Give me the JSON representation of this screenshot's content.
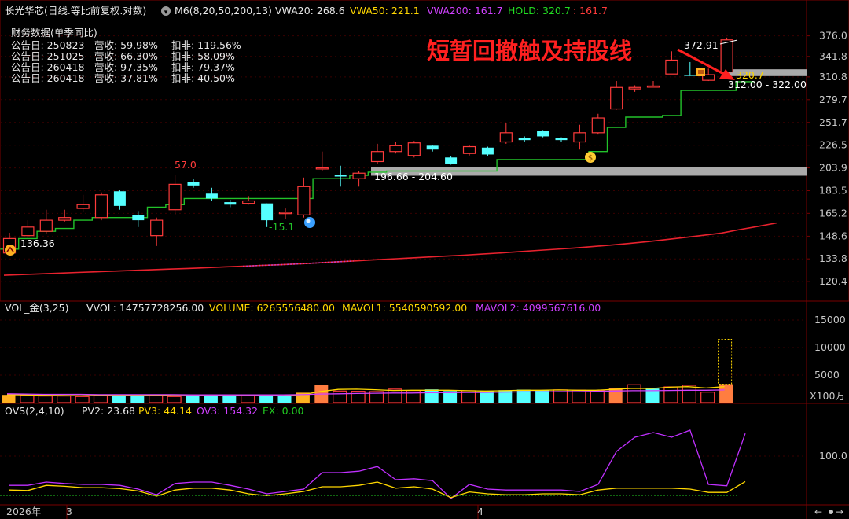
{
  "colors": {
    "background": "#000000",
    "grid": "#3a0000",
    "axis_text": "#c8c8c8",
    "up": "#ff3b3b",
    "down": "#55ffff",
    "hold_line": "#22c22a",
    "ma_red": "#e8222e",
    "ma_magenta": "#c040c0",
    "yellow": "#ffd700",
    "white": "#ffffff",
    "annotation_red": "#ff2020",
    "band": "#aaaaaa",
    "gold_bar": "#ffb020",
    "orange_bar": "#ff7d40",
    "vol_avg_yellow": "#ffd700",
    "vol_avg_magenta": "#d040ff",
    "ovs_purple": "#c030ff",
    "ovs_yellow": "#ffd700",
    "ovs_green": "#22cc22"
  },
  "header": {
    "ticker": "长光华芯(日线.等比前复权.对数)",
    "ma": "M6(8,20,50,200,13)",
    "vwa20": "VWA20: 268.6",
    "vwa50": "VWA50: 221.1",
    "vwa200": "VWA200: 161.7",
    "hold": "HOLD: 320.7",
    "hold2": ": 161.7"
  },
  "finance": {
    "title": "财务数据(单季同比)",
    "rows": [
      {
        "date": "公告日: 250823",
        "rev": "营收:  59.98%",
        "np": "扣非:  119.56%"
      },
      {
        "date": "公告日: 251025",
        "rev": "营收:  66.30%",
        "np": "扣非:  58.09%"
      },
      {
        "date": "公告日: 260418",
        "rev": "营收:  97.35%",
        "np": "扣非:  79.37%"
      },
      {
        "date": "公告日: 260418",
        "rev": "营收:  37.81%",
        "np": "扣非:  40.50%"
      }
    ]
  },
  "annotation": "短暂回撤触及持股线",
  "price_labels": {
    "high": "372.91",
    "hold_value": "320.7",
    "zone_top": "312.00 - 322.00",
    "zone_mid": "196.66 - 204.60",
    "peak_57": "57.0",
    "dip": "-15.1",
    "low": "136.36"
  },
  "volume": {
    "title": "VOL_金(3,25)",
    "vvol": "VVOL: 14757728256.00",
    "volume": "VOLUME: 6265556480.00",
    "mavol1": "MAVOL1: 5540590592.00",
    "mavol2": "MAVOL2: 4099567616.00",
    "unit": "X100万"
  },
  "ovs": {
    "title": "OVS(2,4,10)",
    "pv2": "PV2: 23.68",
    "pv3": "PV3: 44.14",
    "ov3": "OV3: 154.32",
    "ex": "EX: 0.00"
  },
  "xaxis": {
    "year": "2026年",
    "m3": "3",
    "m4": "4"
  },
  "chart_data": [
    {
      "type": "candlestick",
      "scale": "log",
      "y_ticks": [
        120.4,
        133.8,
        148.6,
        165.2,
        183.5,
        203.9,
        226.5,
        251.7,
        279.7,
        310.8,
        341.8,
        376.0
      ],
      "ylim": [
        112.0,
        398.0
      ],
      "candles": [
        {
          "o": 137.5,
          "c": 147.0,
          "h": 151.0,
          "l": 136.4
        },
        {
          "o": 149.0,
          "c": 155.0,
          "h": 160.0,
          "l": 147.5
        },
        {
          "o": 152.0,
          "c": 160.0,
          "h": 168.0,
          "l": 150.5
        },
        {
          "o": 160.0,
          "c": 162.0,
          "h": 168.0,
          "l": 159.0
        },
        {
          "o": 169.0,
          "c": 172.0,
          "h": 180.0,
          "l": 166.0
        },
        {
          "o": 162.0,
          "c": 180.0,
          "h": 182.0,
          "l": 160.0
        },
        {
          "o": 183.0,
          "c": 171.0,
          "h": 184.0,
          "l": 168.0
        },
        {
          "o": 164.0,
          "c": 160.0,
          "h": 167.0,
          "l": 155.0
        },
        {
          "o": 149.0,
          "c": 160.0,
          "h": 162.0,
          "l": 142.0
        },
        {
          "o": 168.0,
          "c": 189.0,
          "h": 197.0,
          "l": 164.0
        },
        {
          "o": 191.0,
          "c": 188.0,
          "h": 194.0,
          "l": 186.0
        },
        {
          "o": 181.0,
          "c": 177.0,
          "h": 186.0,
          "l": 175.0
        },
        {
          "o": 174.0,
          "c": 172.0,
          "h": 176.0,
          "l": 170.0
        },
        {
          "o": 173.0,
          "c": 175.0,
          "h": 179.0,
          "l": 172.0
        },
        {
          "o": 173.0,
          "c": 160.0,
          "h": 173.0,
          "l": 155.0
        },
        {
          "o": 165.0,
          "c": 166.0,
          "h": 169.0,
          "l": 161.0
        },
        {
          "o": 164.0,
          "c": 187.0,
          "h": 195.0,
          "l": 162.0
        },
        {
          "o": 203.0,
          "c": 204.0,
          "h": 220.0,
          "l": 201.0
        },
        {
          "o": 197.0,
          "c": 196.5,
          "h": 206.0,
          "l": 187.0
        },
        {
          "o": 194.0,
          "c": 199.0,
          "h": 201.0,
          "l": 187.0
        },
        {
          "o": 210.0,
          "c": 220.0,
          "h": 228.0,
          "l": 208.0
        },
        {
          "o": 220.0,
          "c": 226.0,
          "h": 230.0,
          "l": 218.0
        },
        {
          "o": 216.0,
          "c": 229.0,
          "h": 231.0,
          "l": 214.0
        },
        {
          "o": 226.0,
          "c": 222.0,
          "h": 227.0,
          "l": 220.0
        },
        {
          "o": 214.0,
          "c": 208.0,
          "h": 215.0,
          "l": 207.0
        },
        {
          "o": 218.0,
          "c": 225.0,
          "h": 227.0,
          "l": 216.0
        },
        {
          "o": 224.0,
          "c": 217.0,
          "h": 225.0,
          "l": 215.0
        },
        {
          "o": 230.0,
          "c": 240.0,
          "h": 251.0,
          "l": 228.0
        },
        {
          "o": 234.0,
          "c": 232.0,
          "h": 236.0,
          "l": 230.0
        },
        {
          "o": 242.0,
          "c": 236.0,
          "h": 243.0,
          "l": 235.0
        },
        {
          "o": 234.0,
          "c": 232.0,
          "h": 235.0,
          "l": 230.0
        },
        {
          "o": 230.0,
          "c": 240.0,
          "h": 249.0,
          "l": 222.0
        },
        {
          "o": 240.0,
          "c": 257.0,
          "h": 262.0,
          "l": 238.0
        },
        {
          "o": 268.0,
          "c": 296.0,
          "h": 305.0,
          "l": 267.0
        },
        {
          "o": 294.0,
          "c": 296.0,
          "h": 299.0,
          "l": 290.0
        },
        {
          "o": 297.0,
          "c": 298.0,
          "h": 305.0,
          "l": 296.0
        },
        {
          "o": 315.0,
          "c": 336.0,
          "h": 350.0,
          "l": 315.0
        },
        {
          "o": 314.0,
          "c": 313.0,
          "h": 333.0,
          "l": 312.0
        },
        {
          "o": 306.0,
          "c": 314.0,
          "h": 323.0,
          "l": 305.0
        },
        {
          "o": 318.0,
          "c": 369.0,
          "h": 372.91,
          "l": 318.0
        }
      ],
      "hold_line": [
        140,
        147,
        152,
        154,
        160,
        162,
        162,
        162,
        170,
        172,
        177,
        177,
        177,
        177,
        177,
        177,
        177,
        194,
        194,
        197,
        200,
        201,
        201,
        201,
        201,
        201,
        201,
        212,
        212,
        212,
        212,
        212,
        220,
        246,
        258,
        258,
        260,
        292,
        292,
        292,
        304
      ],
      "ma_red": [
        124,
        124.4,
        124.8,
        125.2,
        125.6,
        126,
        126.4,
        126.8,
        127.2,
        127.6,
        128,
        128.4,
        128.9,
        129.3,
        129.8,
        130.2,
        130.7,
        131.3,
        131.9,
        132.5,
        133.1,
        133.7,
        134.3,
        134.9,
        135.5,
        136.1,
        136.8,
        137.5,
        138.3,
        139.1,
        139.9,
        140.7,
        141.6,
        142.6,
        143.7,
        144.9,
        146.3,
        147.7,
        149.2,
        150.8,
        153.2,
        155.5,
        158
      ],
      "bands": [
        {
          "label": "196.66 - 204.60",
          "low": 196.66,
          "high": 204.6
        },
        {
          "label": "312.00 - 322.00",
          "low": 312.0,
          "high": 322.0
        }
      ]
    },
    {
      "type": "bar",
      "name": "volume",
      "y_ticks": [
        5000,
        10000,
        15000
      ],
      "ylim": [
        0,
        16000
      ],
      "values": [
        1400,
        1300,
        1200,
        1200,
        1100,
        1400,
        1250,
        1350,
        1300,
        1100,
        1400,
        1450,
        1350,
        1250,
        1300,
        1250,
        1800,
        3150,
        2100,
        2050,
        2000,
        2450,
        2200,
        2400,
        2100,
        2150,
        2150,
        2250,
        2350,
        2250,
        2300,
        2250,
        2200,
        2700,
        3250,
        2550,
        2850,
        3150,
        1900,
        3350
      ],
      "colors": [
        "gold",
        "up",
        "up",
        "up",
        "up",
        "up",
        "down",
        "down",
        "up",
        "up",
        "down",
        "down",
        "down",
        "up",
        "down",
        "down",
        "gold",
        "orange",
        "up",
        "up",
        "up",
        "up",
        "up",
        "down",
        "down",
        "up",
        "down",
        "down",
        "down",
        "down",
        "up",
        "up",
        "up",
        "orange",
        "up",
        "down",
        "up",
        "up",
        "up",
        "orange"
      ],
      "mavol1": [
        1450,
        1400,
        1350,
        1300,
        1250,
        1300,
        1350,
        1350,
        1300,
        1250,
        1250,
        1350,
        1400,
        1350,
        1300,
        1250,
        1400,
        2000,
        2400,
        2450,
        2350,
        2200,
        2250,
        2250,
        2250,
        2150,
        2100,
        2150,
        2250,
        2250,
        2300,
        2250,
        2250,
        2400,
        2600,
        2550,
        2800,
        2900,
        2650,
        2900
      ],
      "mavol2": [
        1600,
        1550,
        1500,
        1500,
        1500,
        1450,
        1450,
        1450,
        1450,
        1450,
        1400,
        1400,
        1400,
        1400,
        1400,
        1400,
        1450,
        1550,
        1600,
        1650,
        1700,
        1750,
        1750,
        1800,
        1800,
        1850,
        1850,
        1900,
        1950,
        1950,
        2000,
        2000,
        2050,
        2100,
        2150,
        2150,
        2200,
        2250,
        2250,
        2300
      ],
      "highlight_box": {
        "index": 39,
        "top": 11500
      }
    },
    {
      "type": "line",
      "name": "ovs",
      "y_ticks": [
        100.0
      ],
      "ylim": [
        0,
        200
      ],
      "ov3": [
        38,
        38,
        45,
        42,
        40,
        40,
        38,
        30,
        18,
        42,
        45,
        45,
        38,
        30,
        20,
        25,
        30,
        65,
        65,
        68,
        78,
        50,
        52,
        48,
        10,
        40,
        30,
        28,
        28,
        28,
        28,
        25,
        40,
        110,
        140,
        150,
        140,
        155,
        40,
        37,
        148
      ],
      "pv3": [
        28,
        27,
        38,
        36,
        33,
        33,
        31,
        26,
        15,
        28,
        32,
        32,
        28,
        20,
        16,
        20,
        25,
        35,
        35,
        38,
        45,
        32,
        35,
        30,
        12,
        24,
        20,
        18,
        18,
        20,
        20,
        18,
        28,
        32,
        32,
        32,
        32,
        30,
        23,
        23,
        46
      ],
      "ex": 0,
      "baseline_y_value": 17
    }
  ]
}
